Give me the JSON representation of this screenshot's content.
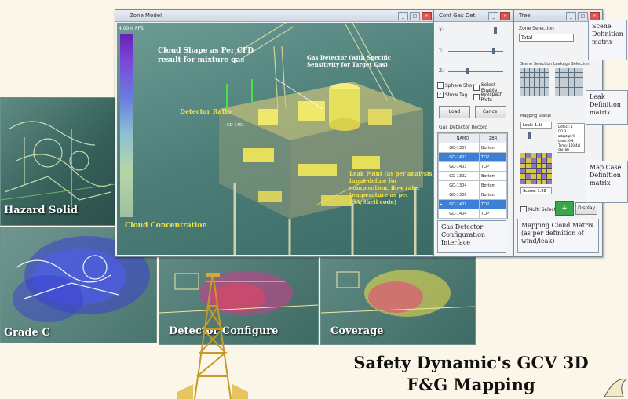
{
  "background": {
    "thumbnails": [
      {
        "label": "Hazard Solid"
      },
      {
        "label": "Grade C"
      },
      {
        "label": "Detector Configure"
      },
      {
        "label": "Coverage"
      }
    ]
  },
  "zone_model_window": {
    "title": "Zone Model",
    "legend_top": "4.00% PFS",
    "annotations": {
      "cloud_shape": "Cloud Shape as Per CFD result for mixture gas",
      "gas_detector": "Gas Detector (with Specific Sensitivity for Target Gas)",
      "detector_ratio": "Detector Ratio",
      "leak_point": "Leak Point (as per analysis input define for composition, flow rate, temperature as per ISA/Shell code)",
      "cloud_concentration": "Cloud Concentration",
      "detector_tag": "GD-1401"
    }
  },
  "conf_window": {
    "title": "Conf Gas Det",
    "slider_labels": [
      "X:",
      "Y:",
      "Z:"
    ],
    "checkboxes": [
      {
        "label": "Sphere Show",
        "checked": false
      },
      {
        "label": "Select Enable",
        "checked": false
      },
      {
        "label": "Show Tag",
        "checked": true
      },
      {
        "label": "eyespath Plots",
        "checked": false
      }
    ],
    "load_label": "Load",
    "cancel_label": "Cancel",
    "record_title": "Gas Detector Record",
    "record_headers": [
      "",
      "NAMDI",
      "ZBR"
    ],
    "records": [
      {
        "name": "GD-1307",
        "zone": "Bottom",
        "selected": false
      },
      {
        "name": "GD-1403",
        "zone": "TOP",
        "selected": true
      },
      {
        "name": "GD-1403",
        "zone": "TOP",
        "selected": false
      },
      {
        "name": "GD-1302",
        "zone": "Bottom",
        "selected": false
      },
      {
        "name": "GD-1304",
        "zone": "Bottom",
        "selected": false
      },
      {
        "name": "GD-1306",
        "zone": "Bottom",
        "selected": false
      },
      {
        "name": "GD-1401",
        "zone": "TOP",
        "selected": true
      },
      {
        "name": "GD-1404",
        "zone": "TOP",
        "selected": false
      }
    ],
    "callout": "Gas Detector Configuration Interface"
  },
  "tree_window": {
    "title": "Tree",
    "zone_selection_label": "Zone Selection",
    "zone_value": "Total",
    "scene_selection_label": "Scene Selection",
    "leakage_selection_label": "Leakage Selection",
    "mapping_status_label": "Mapping Status",
    "leak_value": "Leak: 1.1f",
    "scene_value": "Scene: 1.58",
    "info_lines": [
      "Detect: 1",
      "OO 3",
      "adopt pt.%",
      "Leakl: 0.9",
      "Temp: 160.4pl",
      "SM: PN"
    ],
    "multi_select_label": "Multi Select",
    "display_label": "Display",
    "callout_scene": "Scene Definition matrix",
    "callout_leak": "Leak Definition matrix",
    "callout_mapcase": "Map Case Definition matrix",
    "callout_mapping": "Mapping Cloud Matrix (as per definition of wind/leak)"
  },
  "caption": {
    "line1": "Safety Dynamic's GCV 3D",
    "line2": "F&G Mapping"
  },
  "colors": {
    "scene_bg": "#3a6b66",
    "selected_row": "#3b7fd6",
    "annotation_yellow": "#f2e24a",
    "annotation_white": "#ffffff"
  }
}
